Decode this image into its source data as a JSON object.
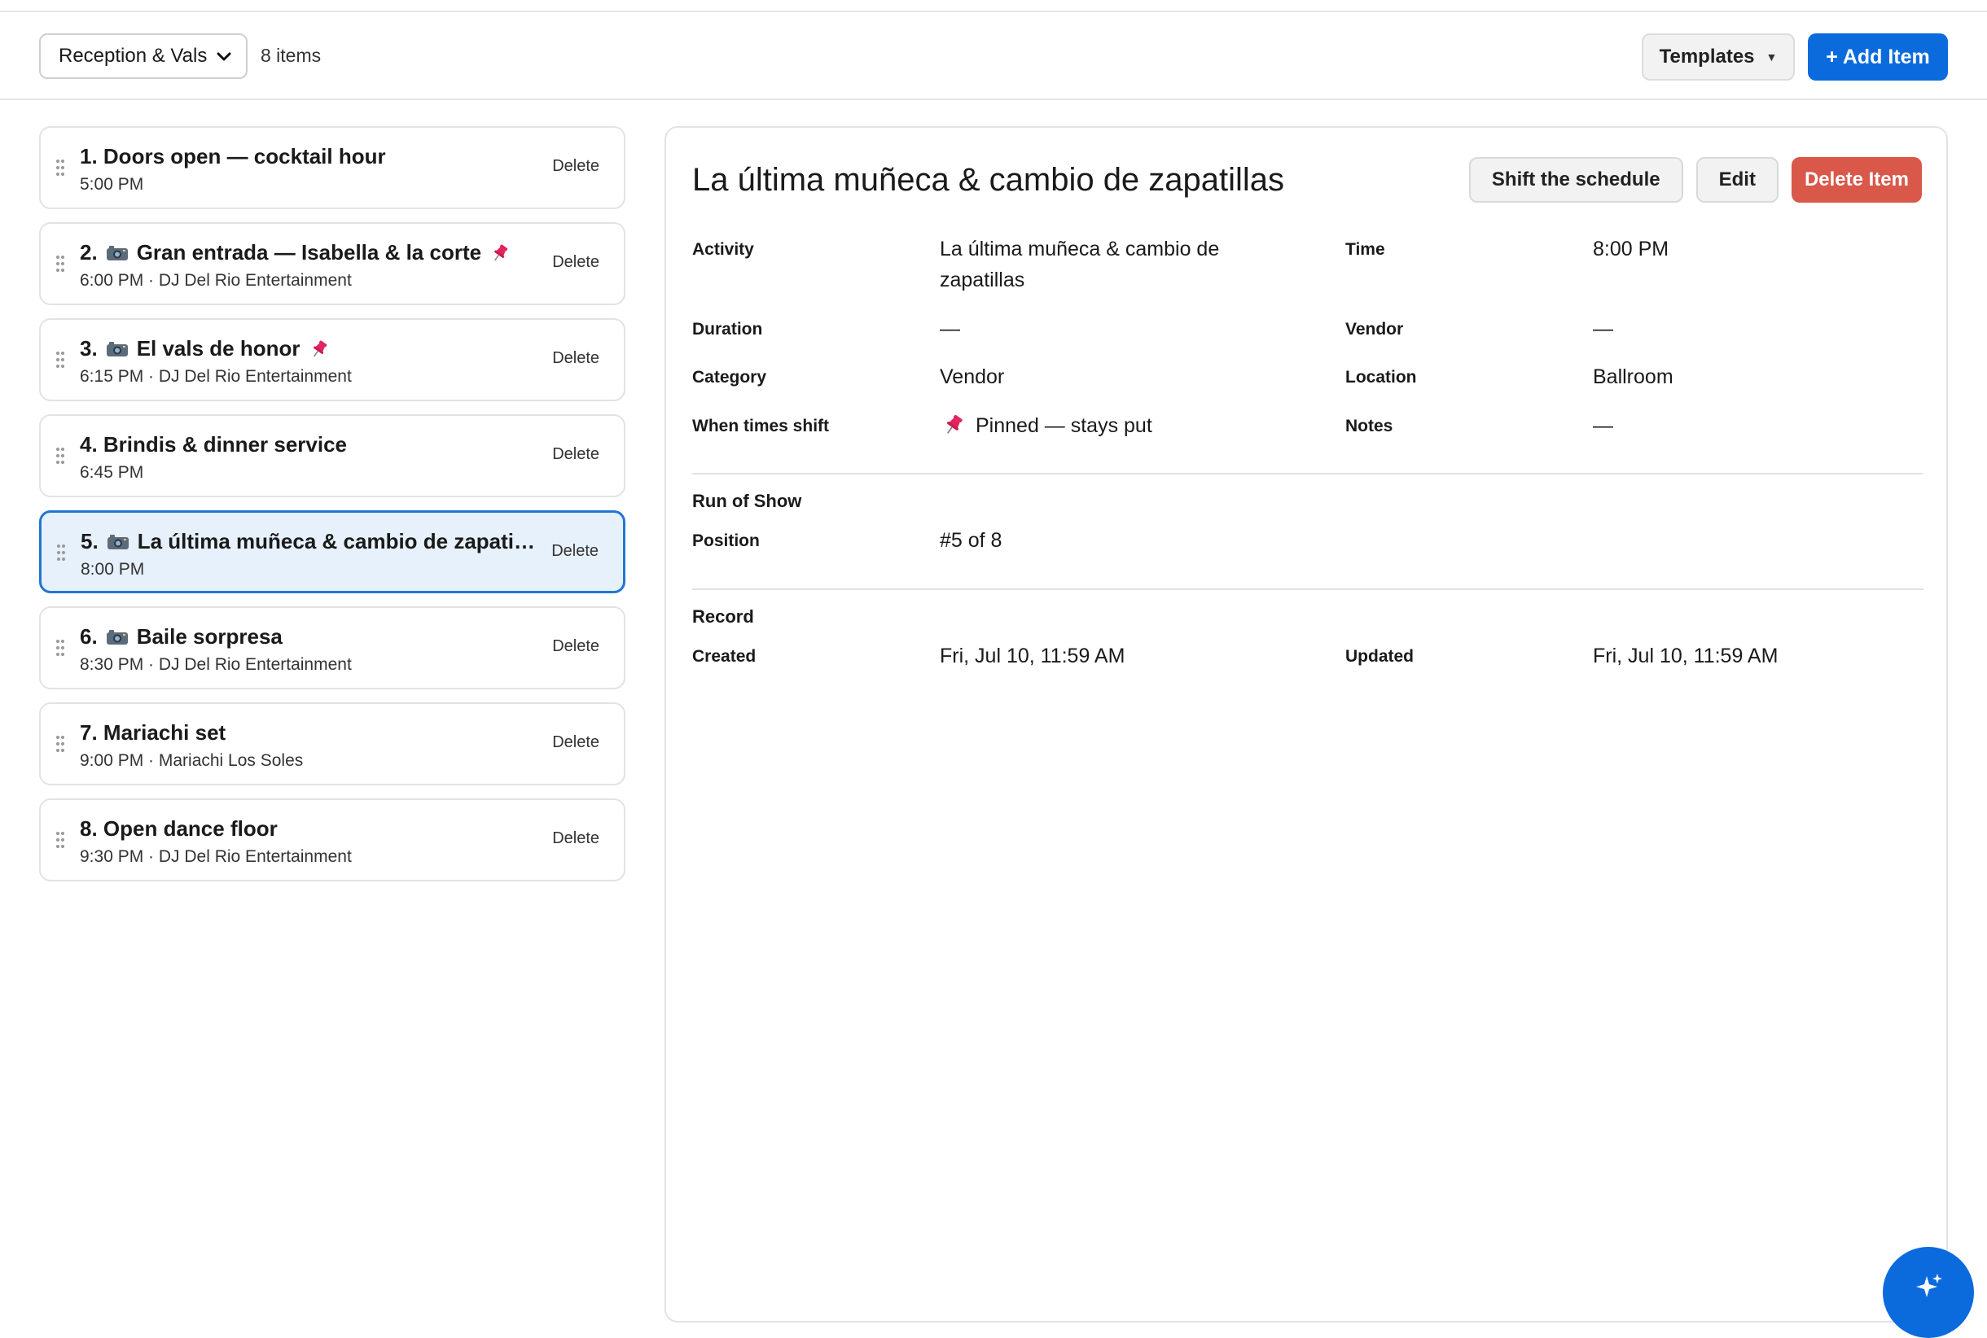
{
  "toolbar": {
    "select_value": "Reception & Vals",
    "item_count": "8 items",
    "templates_label": "Templates",
    "add_item_label": "+ Add Item"
  },
  "items": [
    {
      "title": "1. Doors open — cocktail hour",
      "meta": "5:00 PM",
      "delete": "Delete",
      "camera": false,
      "pinned": false
    },
    {
      "title": "Gran entrada — Isabella & la corte",
      "num": "2.",
      "meta": "6:00 PM · DJ Del Rio Entertainment",
      "delete": "Delete",
      "camera": true,
      "pinned": true
    },
    {
      "title": "El vals de honor",
      "num": "3.",
      "meta": "6:15 PM · DJ Del Rio Entertainment",
      "delete": "Delete",
      "camera": true,
      "pinned": true
    },
    {
      "title": "4. Brindis & dinner service",
      "meta": "6:45 PM",
      "delete": "Delete",
      "camera": false,
      "pinned": false
    },
    {
      "title": "La última muñeca & cambio de zapatil...",
      "num": "5.",
      "meta": "8:00 PM",
      "delete": "Delete",
      "camera": true,
      "pinned": false
    },
    {
      "title": "Baile sorpresa",
      "num": "6.",
      "meta": "8:30 PM · DJ Del Rio Entertainment",
      "delete": "Delete",
      "camera": true,
      "pinned": false
    },
    {
      "title": "7. Mariachi set",
      "meta": "9:00 PM · Mariachi Los Soles",
      "delete": "Delete",
      "camera": false,
      "pinned": false
    },
    {
      "title": "8. Open dance floor",
      "meta": "9:30 PM · DJ Del Rio Entertainment",
      "delete": "Delete",
      "camera": false,
      "pinned": false
    }
  ],
  "detail": {
    "title": "La última muñeca & cambio de zapatillas",
    "shift_label": "Shift the schedule",
    "edit_label": "Edit",
    "delete_label": "Delete Item",
    "fields": {
      "activity_label": "Activity",
      "activity_line1": "La última muñeca & cambio de",
      "activity_line2": "zapatillas",
      "time_label": "Time",
      "time_value": "8:00 PM",
      "duration_label": "Duration",
      "duration_value": "—",
      "vendor_label": "Vendor",
      "vendor_value": "—",
      "category_label": "Category",
      "category_value": "Vendor",
      "location_label": "Location",
      "location_value": "Ballroom",
      "shift_label": "When times shift",
      "shift_value": "Pinned — stays put",
      "notes_label": "Notes",
      "notes_value": "—"
    },
    "run_of_show": {
      "heading": "Run of Show",
      "position_label": "Position",
      "position_value": "#5 of 8"
    },
    "record": {
      "heading": "Record",
      "created_label": "Created",
      "created_value": "Fri, Jul 10, 11:59 AM",
      "updated_label": "Updated",
      "updated_value": "Fri, Jul 10, 11:59 AM"
    }
  },
  "colors": {
    "accent": "#0b6bdc",
    "danger": "#d9584a",
    "selected_bg": "#e6f1fc",
    "pin": "#e0245e"
  }
}
